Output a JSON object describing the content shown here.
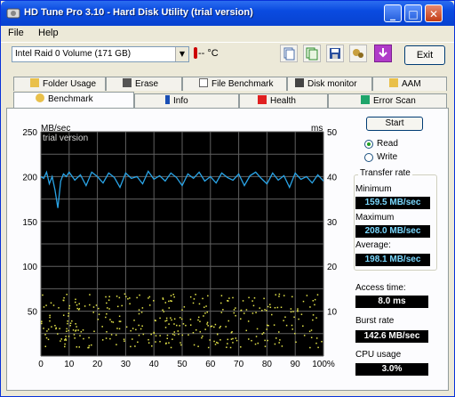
{
  "window": {
    "title": "HD Tune Pro 3.10 - Hard Disk Utility (trial version)"
  },
  "menu": {
    "file": "File",
    "help": "Help"
  },
  "toolbar": {
    "drive": "Intel   Raid 0 Volume (171 GB)",
    "temperature": "-- °C",
    "exit_label": "Exit"
  },
  "tabs": {
    "row1": [
      "Folder Usage",
      "Erase",
      "File Benchmark",
      "Disk monitor",
      "AAM"
    ],
    "row2": [
      "Benchmark",
      "Info",
      "Health",
      "Error Scan"
    ]
  },
  "panel": {
    "start_label": "Start",
    "read_label": "Read",
    "write_label": "Write",
    "mode": "read",
    "transfer_rate_label": "Transfer rate",
    "minimum_label": "Minimum",
    "minimum_value": "159.5 MB/sec",
    "maximum_label": "Maximum",
    "maximum_value": "208.0 MB/sec",
    "average_label": "Average:",
    "average_value": "198.1 MB/sec",
    "access_time_label": "Access time:",
    "access_time_value": "8.0 ms",
    "burst_rate_label": "Burst rate",
    "burst_rate_value": "142.6 MB/sec",
    "cpu_usage_label": "CPU usage",
    "cpu_usage_value": "3.0%"
  },
  "chart_data": {
    "type": "line",
    "watermark": "trial version",
    "left_unit": "MB/sec",
    "right_unit": "ms",
    "ylim_left": [
      0,
      250
    ],
    "ylim_right": [
      0,
      50
    ],
    "xlim": [
      0,
      100
    ],
    "x_ticks": [
      "0",
      "10",
      "20",
      "30",
      "40",
      "50",
      "60",
      "70",
      "80",
      "90",
      "100%"
    ],
    "y_left_ticks": [
      "250",
      "200",
      "150",
      "100",
      "50"
    ],
    "y_right_ticks": [
      "50",
      "40",
      "30",
      "20",
      "10"
    ],
    "grid": true,
    "colors": {
      "transfer": "#2aa5e8",
      "access": "#e6e64a",
      "background": "#000000",
      "grid": "#606060"
    },
    "series": [
      {
        "name": "transfer rate",
        "axis": "left",
        "x": [
          0,
          1,
          2,
          3,
          4,
          5,
          6,
          7,
          8,
          9,
          10,
          12,
          14,
          16,
          18,
          20,
          22,
          24,
          26,
          28,
          30,
          32,
          34,
          36,
          38,
          40,
          42,
          44,
          46,
          48,
          50,
          52,
          54,
          56,
          58,
          60,
          62,
          64,
          66,
          68,
          70,
          72,
          74,
          76,
          78,
          80,
          82,
          84,
          86,
          88,
          90,
          92,
          94,
          96,
          98,
          100
        ],
        "y": [
          200,
          198,
          205,
          192,
          200,
          185,
          165,
          195,
          203,
          200,
          205,
          196,
          202,
          190,
          205,
          200,
          193,
          204,
          199,
          188,
          204,
          198,
          200,
          192,
          206,
          197,
          201,
          195,
          204,
          199,
          190,
          203,
          198,
          205,
          195,
          200,
          193,
          204,
          199,
          196,
          203,
          190,
          201,
          205,
          198,
          192,
          204,
          196,
          201,
          188,
          204,
          197,
          200,
          193,
          202,
          195
        ]
      }
    ],
    "access_points_note": "scatter of access times, roughly 2–14 ms across the full range",
    "access_y_range_ms": [
      2,
      14
    ]
  }
}
